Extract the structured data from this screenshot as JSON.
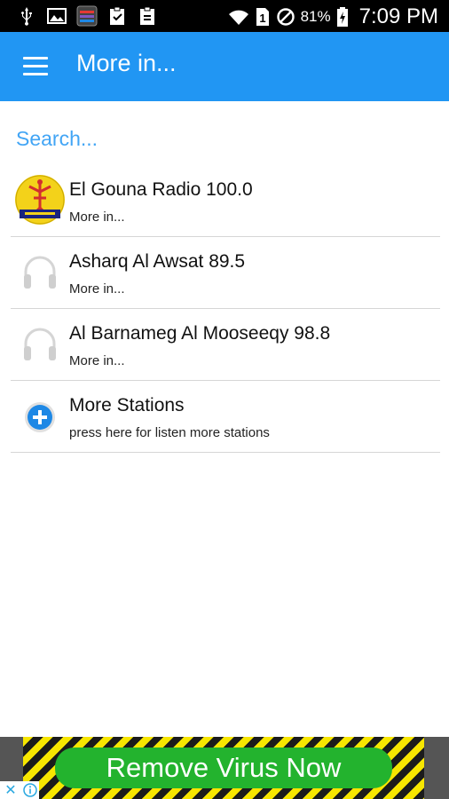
{
  "status_bar": {
    "battery_percent": "81%",
    "time": "7:09 PM",
    "sim_slot": "1",
    "icons": [
      "usb-icon",
      "gallery-icon",
      "app-icon",
      "clipboard-check-icon",
      "clipboard-icon",
      "wifi-icon",
      "sim-icon",
      "blocked-icon",
      "battery-charging-icon"
    ]
  },
  "app_bar": {
    "title": "More in...",
    "color": "#2196f3"
  },
  "search": {
    "placeholder": "Search..."
  },
  "stations": [
    {
      "name": "El Gouna Radio 100.0",
      "subtitle": "More in...",
      "icon": "el-gouna-logo"
    },
    {
      "name": "Asharq Al Awsat 89.5",
      "subtitle": "More in...",
      "icon": "headphones-icon"
    },
    {
      "name": "Al Barnameg Al Mooseeqy 98.8",
      "subtitle": "More in...",
      "icon": "headphones-icon"
    },
    {
      "name": "More Stations",
      "subtitle": "press here for listen more stations",
      "icon": "plus-circle-icon"
    }
  ],
  "ad": {
    "text": "Remove Virus Now",
    "close_label": "✕"
  }
}
